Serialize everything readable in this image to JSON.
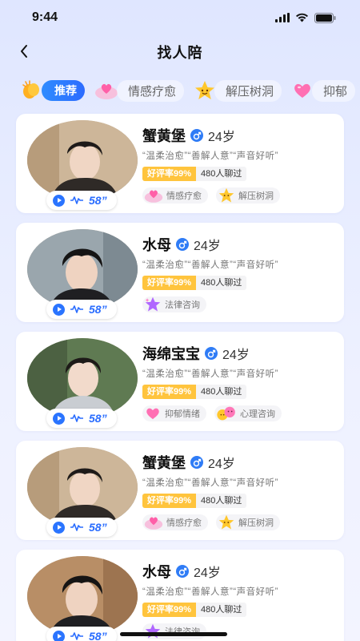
{
  "status_bar": {
    "time": "9:44"
  },
  "nav": {
    "title": "找人陪"
  },
  "tabs": [
    {
      "label": "推荐",
      "icon": "clapping-hands-icon",
      "active": true
    },
    {
      "label": "情感疗愈",
      "icon": "heart-cloud-icon",
      "active": false
    },
    {
      "label": "解压树洞",
      "icon": "star-face-icon",
      "active": false
    },
    {
      "label": "抑郁",
      "icon": "pink-heart-icon",
      "active": false
    }
  ],
  "cards": [
    {
      "name": "蟹黄堡",
      "age": "24岁",
      "tags": "“温柔治愈”“善解人意”“声音好听”",
      "rating": "好评率99%",
      "chats": "480人聊过",
      "duration": "58”",
      "categories": [
        {
          "label": "情感疗愈",
          "icon": "heart-cloud-icon"
        },
        {
          "label": "解压树洞",
          "icon": "star-face-icon"
        }
      ]
    },
    {
      "name": "水母",
      "age": "24岁",
      "tags": "“温柔治愈”“善解人意”“声音好听”",
      "rating": "好评率99%",
      "chats": "480人聊过",
      "duration": "58”",
      "categories": [
        {
          "label": "法律咨询",
          "icon": "purple-star-icon"
        }
      ]
    },
    {
      "name": "海绵宝宝",
      "age": "24岁",
      "tags": "“温柔治愈”“善解人意”“声音好听”",
      "rating": "好评率99%",
      "chats": "480人聊过",
      "duration": "58”",
      "categories": [
        {
          "label": "抑郁情绪",
          "icon": "pink-heart-icon"
        },
        {
          "label": "心理咨询",
          "icon": "emoji-faces-icon"
        }
      ]
    },
    {
      "name": "蟹黄堡",
      "age": "24岁",
      "tags": "“温柔治愈”“善解人意”“声音好听”",
      "rating": "好评率99%",
      "chats": "480人聊过",
      "duration": "58”",
      "categories": [
        {
          "label": "情感疗愈",
          "icon": "heart-cloud-icon"
        },
        {
          "label": "解压树洞",
          "icon": "star-face-icon"
        }
      ]
    },
    {
      "name": "水母",
      "age": "24岁",
      "tags": "“温柔治愈”“善解人意”“声音好听”",
      "rating": "好评率99%",
      "chats": "480人聊过",
      "duration": "58”",
      "categories": [
        {
          "label": "法律咨询",
          "icon": "purple-star-icon"
        }
      ]
    }
  ],
  "colors": {
    "accent": "#2c6bff",
    "rating_bg": "#ffc43d",
    "gender": "#2f7cf6"
  }
}
